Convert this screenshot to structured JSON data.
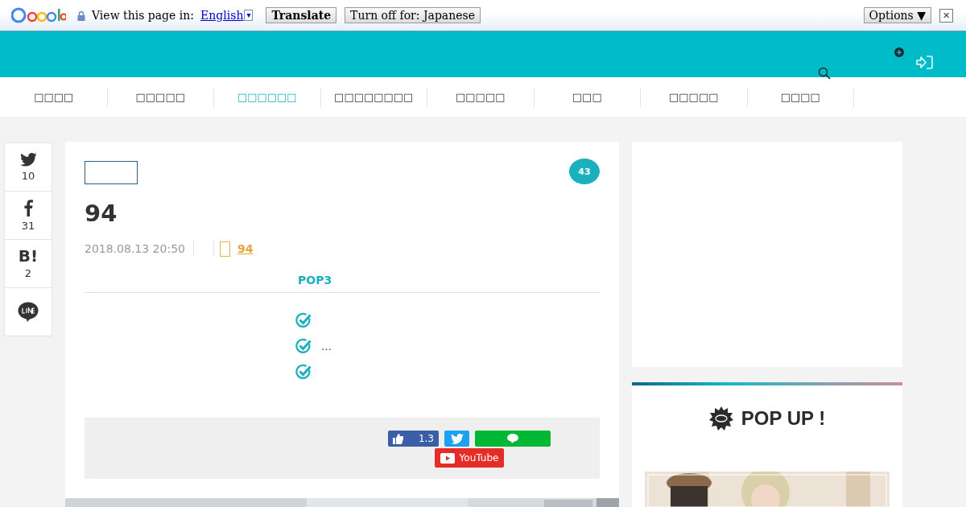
{
  "translate_bar": {
    "prompt": "View this page in:",
    "language": "English",
    "language_caret": "▾",
    "translate_button": "Translate",
    "turn_off_button": "Turn off for: Japanese",
    "options_button": "Options ▼",
    "close": "✕"
  },
  "nav": {
    "items": [
      {
        "label": "□□□□",
        "selected": false
      },
      {
        "label": "□□□□□",
        "selected": false
      },
      {
        "label": "□□□□□□",
        "selected": true
      },
      {
        "label": "□□□□□□□□",
        "selected": false
      },
      {
        "label": "□□□□□",
        "selected": false
      },
      {
        "label": "□□□",
        "selected": false
      },
      {
        "label": "□□□□□",
        "selected": false
      },
      {
        "label": "□□□□",
        "selected": false
      }
    ]
  },
  "share_sidebar": [
    {
      "kind": "twitter",
      "count": "10"
    },
    {
      "kind": "facebook",
      "count": "31"
    },
    {
      "kind": "hatena",
      "icon_text": "B!",
      "count": "2"
    },
    {
      "kind": "line"
    }
  ],
  "article": {
    "comment_count": "43",
    "title": "94",
    "date": "2018.08.13 20:50",
    "author": "94",
    "section_label": "POP3",
    "checklist": [
      {
        "kind": "check"
      },
      {
        "kind": "check",
        "text": "…"
      },
      {
        "kind": "check"
      }
    ],
    "share_buttons": [
      {
        "kind": "facebook",
        "count": "1.3"
      },
      {
        "kind": "twitter"
      },
      {
        "kind": "line"
      },
      {
        "kind": "youtube",
        "label": "YouTube"
      }
    ]
  },
  "sidebar": {
    "heading": "POP UP !"
  }
}
